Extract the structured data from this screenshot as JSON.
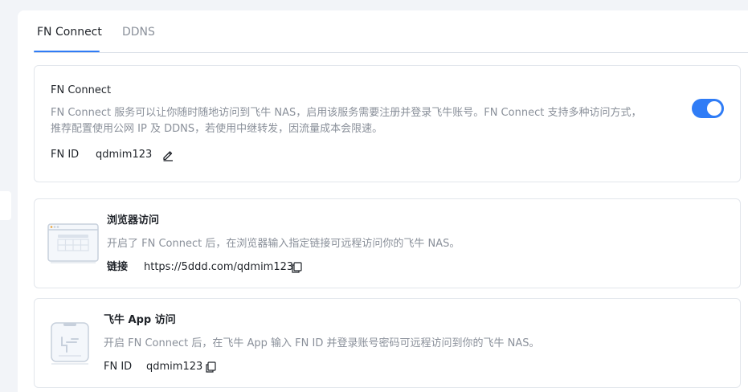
{
  "tabs": [
    {
      "label": "FN Connect",
      "active": true
    },
    {
      "label": "DDNS",
      "active": false
    }
  ],
  "fn_connect": {
    "title": "FN Connect",
    "description_line1": "FN Connect 服务可以让你随时随地访问到飞牛 NAS，启用该服务需要注册并登录飞牛账号。FN Connect 支持多种访问方式，",
    "description_line2": "推荐配置使用公网 IP 及 DDNS，若使用中继转发，因流量成本会限速。",
    "id_label": "FN ID",
    "id_value": "qdmim123",
    "enabled": true
  },
  "browser_access": {
    "title": "浏览器访问",
    "description": "开启了 FN Connect 后，在浏览器输入指定链接可远程访问你的飞牛 NAS。",
    "link_label": "链接",
    "link_value": "https://5ddd.com/qdmim123"
  },
  "app_access": {
    "title": "飞牛 App 访问",
    "description": "开启 FN Connect 后，在飞牛 App 输入 FN ID 并登录账号密码可远程访问到你的飞牛 NAS。",
    "id_label": "FN ID",
    "id_value": "qdmim123"
  },
  "colors": {
    "accent": "#2f7cf6",
    "muted_text": "#8a909a",
    "border": "#e2e6ec",
    "background": "#f2f4f8"
  },
  "icons": {
    "edit": "pencil-icon",
    "copy": "copy-icon",
    "browser_illustration": "browser-window-icon",
    "app_illustration": "phone-app-icon"
  }
}
